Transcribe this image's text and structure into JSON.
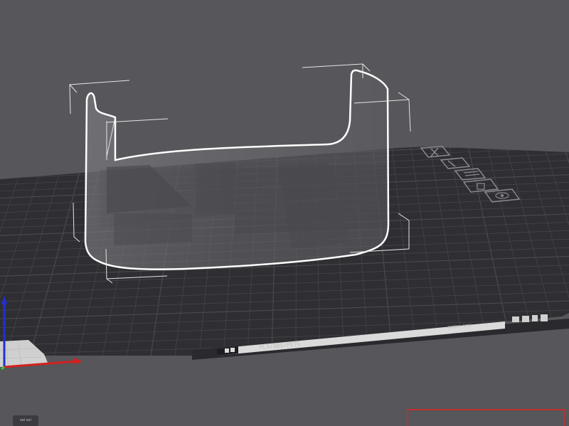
{
  "scene": {
    "background": "#56565b",
    "bed_color": "#2f2f33",
    "grid_color": "#4a4a50",
    "object_outline_color": "#ffffff",
    "selection_box_color": "#e6e6e6",
    "highlight_color": "#c0302b"
  },
  "bed": {
    "material_label": "PLA/ABS/PETG",
    "surface_label": "SMOOTH SIDE"
  },
  "bed_icons": [
    {
      "name": "close-icon"
    },
    {
      "name": "tools-icon"
    },
    {
      "name": "layers-icon"
    },
    {
      "name": "lock-icon"
    },
    {
      "name": "eye-icon"
    }
  ],
  "axes": {
    "x_color": "#d42020",
    "y_color": "#2ecc2e",
    "z_color": "#2030d4"
  },
  "corner_tag": {
    "label": "sel sel"
  }
}
